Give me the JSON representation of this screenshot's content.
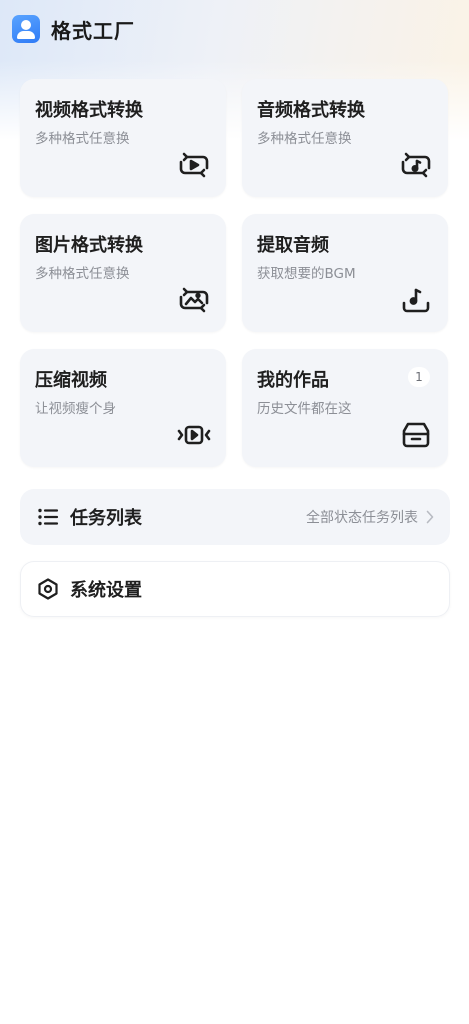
{
  "header": {
    "app_title": "格式工厂",
    "logo_icon": "user-app-icon",
    "accent": "#2f7bf6"
  },
  "cards": [
    {
      "title": "视频格式转换",
      "subtitle": "多种格式任意换",
      "icon": "video-convert-icon"
    },
    {
      "title": "音频格式转换",
      "subtitle": "多种格式任意换",
      "icon": "audio-convert-icon"
    },
    {
      "title": "图片格式转换",
      "subtitle": "多种格式任意换",
      "icon": "image-convert-icon"
    },
    {
      "title": "提取音频",
      "subtitle": "获取想要的BGM",
      "icon": "extract-audio-icon"
    },
    {
      "title": "压缩视频",
      "subtitle": "让视频瘦个身",
      "icon": "compress-video-icon"
    },
    {
      "title": "我的作品",
      "subtitle": "历史文件都在这",
      "icon": "my-works-icon",
      "badge": "1"
    }
  ],
  "task_list": {
    "label": "任务列表",
    "right_text": "全部状态任务列表",
    "icon": "list-icon"
  },
  "settings": {
    "label": "系统设置",
    "icon": "settings-hexagon-icon"
  }
}
